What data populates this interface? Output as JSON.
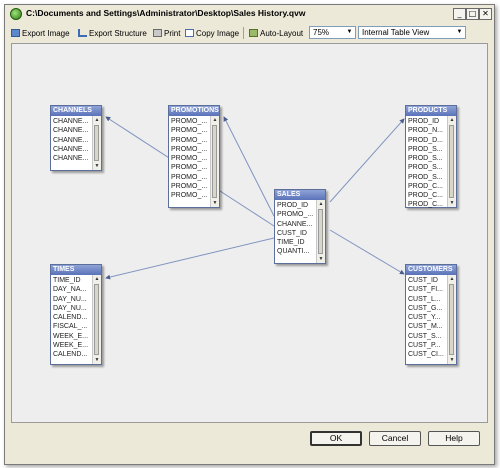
{
  "window": {
    "title": "C:\\Documents and Settings\\Administrator\\Desktop\\Sales History.qvw"
  },
  "titlebar_buttons": {
    "minimize": "_",
    "maximize": "□",
    "close": "✕"
  },
  "toolbar": {
    "export_image": "Export Image",
    "export_structure": "Export Structure",
    "print": "Print",
    "copy_image": "Copy Image",
    "auto_layout": "Auto-Layout",
    "zoom": "75%",
    "view": "Internal Table View"
  },
  "tables": {
    "channels": {
      "name": "CHANNELS",
      "fields": [
        "CHANNE...",
        "CHANNE...",
        "CHANNE...",
        "CHANNE...",
        "CHANNE..."
      ]
    },
    "promotions": {
      "name": "PROMOTIONS",
      "fields": [
        "PROMO_...",
        "PROMO_...",
        "PROMO_...",
        "PROMO_...",
        "PROMO_...",
        "PROMO_...",
        "PROMO_...",
        "PROMO_...",
        "PROMO_..."
      ]
    },
    "products": {
      "name": "PRODUCTS",
      "fields": [
        "PROD_ID",
        "PROD_N...",
        "PROD_D...",
        "PROD_S...",
        "PROD_S...",
        "PROD_S...",
        "PROD_S...",
        "PROD_C...",
        "PROD_C...",
        "PROD_C..."
      ]
    },
    "sales": {
      "name": "SALES",
      "fields": [
        "PROD_ID",
        "PROMO_...",
        "CHANNE...",
        "CUST_ID",
        "TIME_ID",
        "QUANTI..."
      ]
    },
    "times": {
      "name": "TIMES",
      "fields": [
        "TIME_ID",
        "DAY_NA...",
        "DAY_NU...",
        "DAY_NU...",
        "CALEND...",
        "FISCAL_...",
        "WEEK_E...",
        "WEEK_E...",
        "CALEND..."
      ]
    },
    "customers": {
      "name": "CUSTOMERS",
      "fields": [
        "CUST_ID",
        "CUST_FI...",
        "CUST_L...",
        "CUST_G...",
        "CUST_Y...",
        "CUST_M...",
        "CUST_S...",
        "CUST_P...",
        "CUST_CI..."
      ]
    }
  },
  "buttons": {
    "ok": "OK",
    "cancel": "Cancel",
    "help": "Help"
  }
}
